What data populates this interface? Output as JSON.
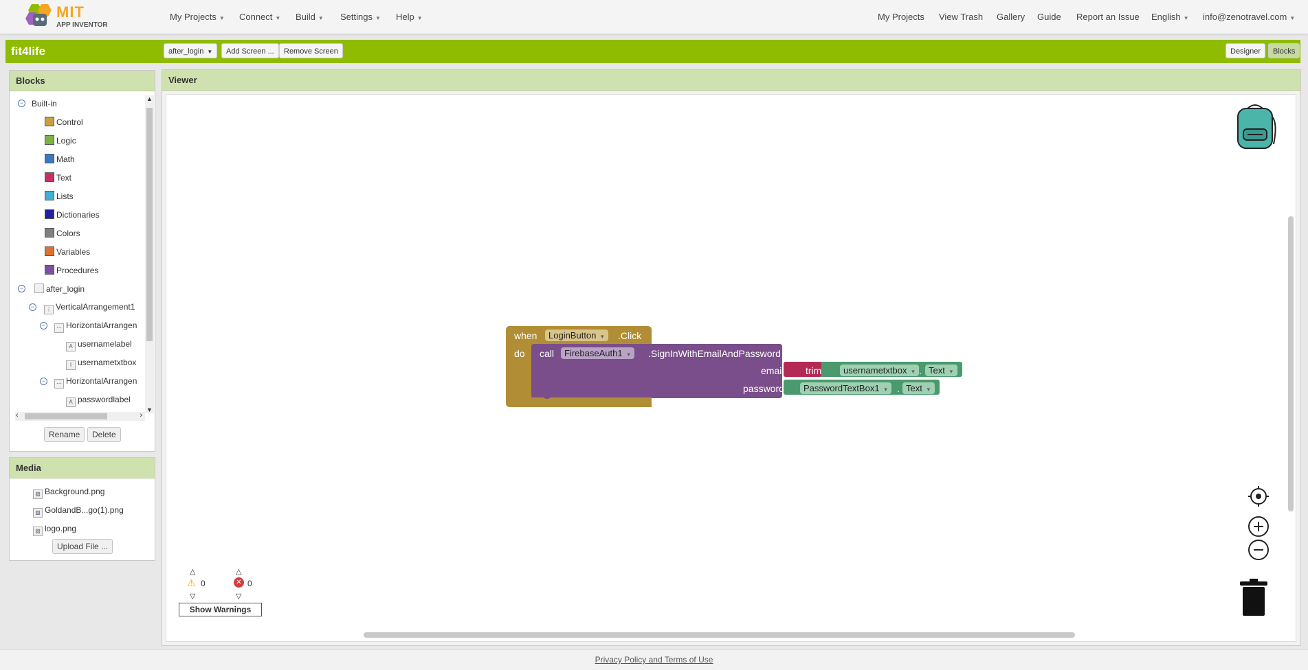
{
  "brand": {
    "name": "MIT",
    "sub": "APP INVENTOR"
  },
  "menu_left": [
    "My Projects",
    "Connect",
    "Build",
    "Settings",
    "Help"
  ],
  "menu_right": {
    "my_projects": "My Projects",
    "view_trash": "View Trash",
    "gallery": "Gallery",
    "guide": "Guide",
    "report": "Report an Issue",
    "language": "English",
    "account": "info@zenotravel.com"
  },
  "project": {
    "name": "fit4life",
    "screen": "after_login",
    "add_screen": "Add Screen ...",
    "remove_screen": "Remove Screen",
    "designer": "Designer",
    "blocks": "Blocks"
  },
  "blocks_panel": {
    "title": "Blocks",
    "builtin": "Built-in",
    "categories": [
      {
        "label": "Control",
        "color": "#c8a040"
      },
      {
        "label": "Logic",
        "color": "#7cb342"
      },
      {
        "label": "Math",
        "color": "#3c78c0"
      },
      {
        "label": "Text",
        "color": "#c83060"
      },
      {
        "label": "Lists",
        "color": "#3cb0d8"
      },
      {
        "label": "Dictionaries",
        "color": "#2020a0"
      },
      {
        "label": "Colors",
        "color": "#808080"
      },
      {
        "label": "Variables",
        "color": "#e07030"
      },
      {
        "label": "Procedures",
        "color": "#8050a0"
      }
    ],
    "screen": "after_login",
    "components": [
      "VerticalArrangement1",
      "HorizontalArrangen",
      "usernamelabel",
      "usernametxtbox",
      "HorizontalArrangen",
      "passwordlabel"
    ],
    "rename": "Rename",
    "delete": "Delete"
  },
  "media_panel": {
    "title": "Media",
    "files": [
      "Background.png",
      "GoldandB...go(1).png",
      "logo.png"
    ],
    "upload": "Upload File ..."
  },
  "viewer": {
    "title": "Viewer",
    "event_when": "when",
    "event_component": "LoginButton",
    "event_name": ".Click",
    "do": "do",
    "call": "call",
    "call_component": "FirebaseAuth1",
    "method": ".SignInWithEmailAndPassword",
    "arg_email": "email",
    "arg_password": "password",
    "trim": "trim",
    "email_component": "usernametxtbox",
    "prop": "Text",
    "password_component": "PasswordTextBox1",
    "dot": ".",
    "warnings_count": "0",
    "errors_count": "0",
    "show_warnings": "Show Warnings"
  },
  "footer": {
    "link": "Privacy Policy and Terms of Use"
  }
}
